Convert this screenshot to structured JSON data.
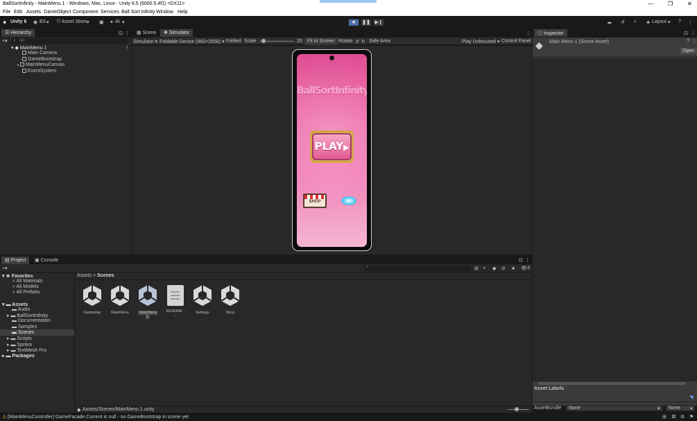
{
  "window": {
    "title": "BallSortInfinity - MainMenu 1 - Windows, Mac, Linux - Unity 6.5 (6000.5.4f1) <DX11>",
    "controls": [
      "—",
      "❐",
      "✕"
    ]
  },
  "menu": [
    "File",
    "Edit",
    "Assets",
    "GameObject",
    "Component",
    "Services",
    "Ball Sort Infinity",
    "Window",
    "Help"
  ],
  "toolbar": {
    "unity_label": "Unity 6",
    "account": "BX",
    "asset_store": "Asset Store",
    "ai": "AI",
    "layout": "Layout"
  },
  "hierarchy": {
    "tab": "Hierarchy",
    "search_placeholder": "All",
    "scene": "MainMenu 1",
    "items": [
      "Main Camera",
      "GameBootstrap",
      "MainMenuCanvas",
      "EventSystem"
    ]
  },
  "view": {
    "tabs": [
      "Scene",
      "Simulator"
    ],
    "simulator_label": "Simulator",
    "device": "Foldable Device (960×2658)",
    "folded": "Folded",
    "scale_label": "Scale",
    "scale_value": "20",
    "fit": "Fit to Screen",
    "rotate": "Rotate",
    "safe_area": "Safe Area",
    "play_mode": "Play Unfocused",
    "control_panel": "Control Panel"
  },
  "game": {
    "title": "BallSortInfinity",
    "play": "PLAY",
    "shop": "SHOP"
  },
  "inspector": {
    "tab": "Inspector",
    "asset_name": "Main Menu 1 (Scene Asset)",
    "open": "Open",
    "asset_labels": "Asset Labels",
    "asset_bundle_label": "AssetBundle",
    "bundle_value": "None",
    "variant_value": "None"
  },
  "project": {
    "tabs": [
      "Project",
      "Console"
    ],
    "favorites_label": "Favorites",
    "favorites": [
      "All Materials",
      "All Models",
      "All Prefabs"
    ],
    "assets_label": "Assets",
    "folders": [
      "Audio",
      "BallSortInfinity",
      "Documentation",
      "Samples",
      "Scenes",
      "Scripts",
      "Sprites",
      "TextMesh Pro"
    ],
    "packages_label": "Packages",
    "breadcrumb": [
      "Assets",
      "Scenes"
    ],
    "files": [
      "Gameplay",
      "MainMenu",
      "MainMenu 1",
      "README - ...",
      "Settings",
      "Shop"
    ],
    "path": "Assets/Scenes/MainMenu 1.unity",
    "hidden_count": "3"
  },
  "status": {
    "message": "[MainMenuController] GameFacade.Current is null - no GameBootstrap in scene yet."
  },
  "colors": {
    "selection": "#4d6c96",
    "panel": "#282828",
    "warning": "#f0c040"
  }
}
